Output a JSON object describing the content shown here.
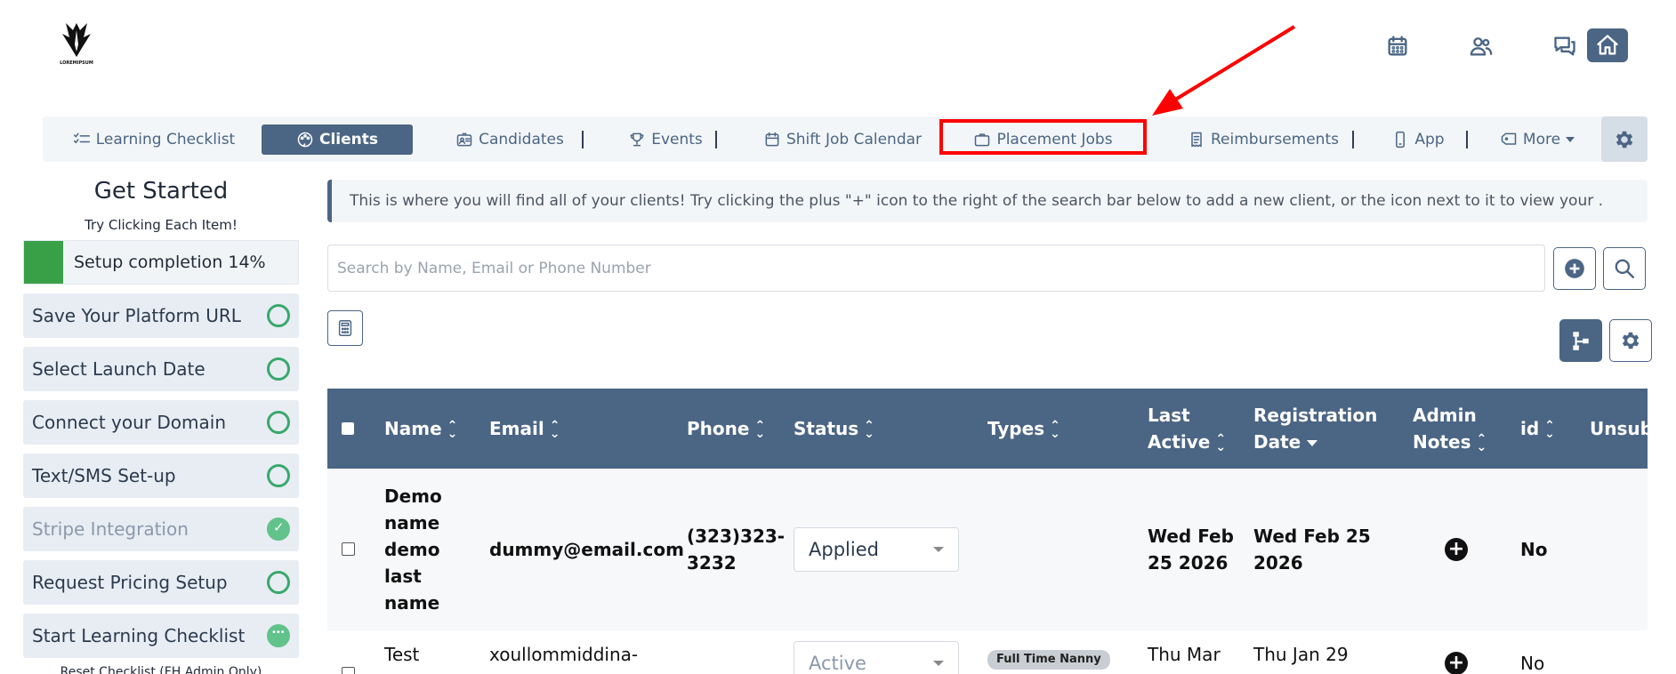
{
  "logo": {
    "text": "LOREMIPSUM"
  },
  "header_icons": [
    "calendar-icon",
    "users-icon",
    "chat-icon",
    "home-icon"
  ],
  "nav": {
    "items": [
      {
        "label": "Learning Checklist",
        "icon": "checklist-icon"
      },
      {
        "label": "Clients",
        "icon": "palette-icon"
      },
      {
        "label": "Candidates",
        "icon": "id-card-icon"
      },
      {
        "label": "Events",
        "icon": "trophy-icon"
      },
      {
        "label": "Shift Job Calendar",
        "icon": "calendar-icon"
      },
      {
        "label": "Placement Jobs",
        "icon": "briefcase-icon"
      },
      {
        "label": "Reimbursements",
        "icon": "receipt-icon"
      },
      {
        "label": "App",
        "icon": "mobile-icon"
      },
      {
        "label": "More",
        "icon": "tag-icon"
      }
    ],
    "active": "Clients"
  },
  "sidebar": {
    "title": "Get Started",
    "subtitle": "Try Clicking Each Item!",
    "progress": {
      "label": "Setup completion 14%",
      "percent": 14
    },
    "items": [
      {
        "label": "Save Your Platform URL",
        "state": "todo"
      },
      {
        "label": "Select Launch Date",
        "state": "todo"
      },
      {
        "label": "Connect your Domain",
        "state": "todo"
      },
      {
        "label": "Text/SMS Set-up",
        "state": "todo"
      },
      {
        "label": "Stripe Integration",
        "state": "done"
      },
      {
        "label": "Request Pricing Setup",
        "state": "todo"
      },
      {
        "label": "Start Learning Checklist",
        "state": "in-progress"
      }
    ],
    "reset": "Reset Checklist (FH Admin Only)"
  },
  "info": "This is where you will find all of your clients! Try clicking the plus \"+\" icon to the right of the search bar below to add a new client, or the icon next to it to view your .",
  "search": {
    "placeholder": "Search by Name, Email or Phone Number",
    "value": ""
  },
  "table": {
    "headers": [
      "Name",
      "Email",
      "Phone",
      "Status",
      "Types",
      "Last Active",
      "Registration Date",
      "Admin Notes",
      "id",
      "Unsubs"
    ],
    "rows": [
      {
        "name": "Demo name demo last name",
        "email": "dummy@email.com",
        "phone": "(323)323-3232",
        "status": "Applied",
        "types": "",
        "last_active": "Wed Feb 25 2026",
        "registration": "Wed Feb 25 2026",
        "id": "No"
      },
      {
        "name": "Test",
        "email": "xoullommiddina-",
        "phone": "",
        "status": "Active",
        "types": "Full Time Nanny",
        "last_active": "Thu Mar",
        "registration": "Thu Jan 29",
        "id": "No"
      }
    ]
  },
  "colors": {
    "primary": "#4b6584",
    "success": "#3aa048",
    "annotation": "#ff0000"
  }
}
